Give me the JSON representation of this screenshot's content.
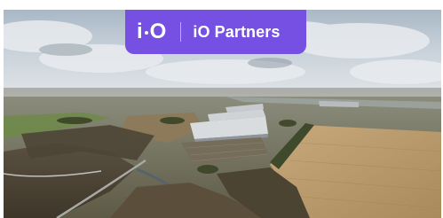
{
  "badge": {
    "logo_letter_i": "i",
    "logo_letter_o": "O",
    "partner_label": "iO Partners",
    "background_color": "#7650e3",
    "text_color": "#ffffff"
  },
  "photo": {
    "subject": "aerial-industrial-park",
    "sky_color": "#c9d2dc",
    "field_color": "#b99b6e"
  }
}
